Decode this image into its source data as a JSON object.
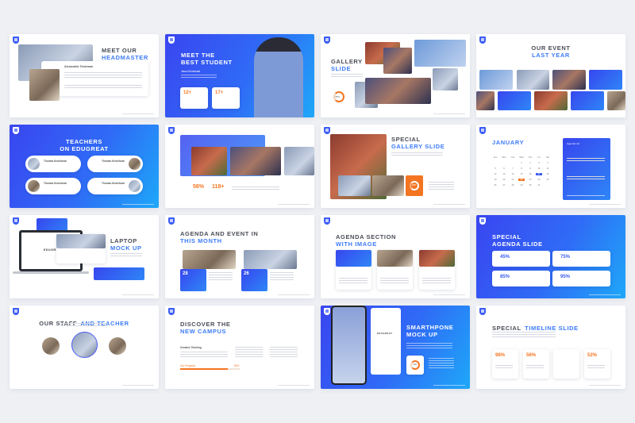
{
  "colors": {
    "accent": "#3c7bf7",
    "blue_bg": "#2f6cf6",
    "orange": "#f47521",
    "page_bg": "#eef0f4"
  },
  "slides": [
    {
      "title1": "MEET OUR",
      "title2": "HEADMASTER",
      "name": "Alexandria Tiedeman"
    },
    {
      "title1": "MEET THE",
      "title2": "BEST STUDENT",
      "name": "Jason Kindewald",
      "stat1": "12+",
      "stat2": "17+"
    },
    {
      "title1": "GALLERY",
      "title2": "SLIDE",
      "progress": "78%"
    },
    {
      "title1": "OUR EVENT",
      "title2": "LAST YEAR"
    },
    {
      "title1": "TEACHERS",
      "title2": "ON EDUGREAT",
      "teacher_name": "Thomas Knoleboat"
    },
    {
      "stat1": "56%",
      "stat2": "118+"
    },
    {
      "title1": "SPECIAL",
      "title2": "GALLERY SLIDE",
      "progress": "68%"
    },
    {
      "title1": "JANUARY",
      "panel_title": "Agenda List",
      "days": [
        "Sun",
        "Mon",
        "Tue",
        "Wed",
        "Thu",
        "Fri",
        "Sat"
      ],
      "highlight_blue": "17",
      "highlight_orange": "22"
    },
    {
      "title1": "LAPTOP",
      "title2": "MOCK UP",
      "brand": "EDUGRE"
    },
    {
      "title1": "AGENDA AND EVENT IN",
      "title2": "THIS MONTH",
      "date1": "28",
      "date2": "26"
    },
    {
      "title1": "AGENDA SECTION",
      "title2": "WITH IMAGE"
    },
    {
      "title1": "SPECIAL",
      "title2": "AGENDA SLIDE",
      "stats": [
        "45%",
        "75%",
        "85%",
        "95%"
      ]
    },
    {
      "title1": "OUR STAFF",
      "title2": "AND TEACHER"
    },
    {
      "title1": "DISCOVER THE",
      "title2": "NEW CAMPUS",
      "col_title": "Creative Thinking",
      "bar_label": "Our Progress",
      "bar_value": "80%",
      "progress": 0.8
    },
    {
      "title1": "SMARTHPONE",
      "title2": "MOCK UP",
      "brand": "EDUGREAT",
      "progress": "78%"
    },
    {
      "title1": "SPECIAL",
      "title2": "TIMELINE SLIDE",
      "stats": [
        "98%",
        "56%",
        "34%",
        "52%"
      ]
    }
  ]
}
